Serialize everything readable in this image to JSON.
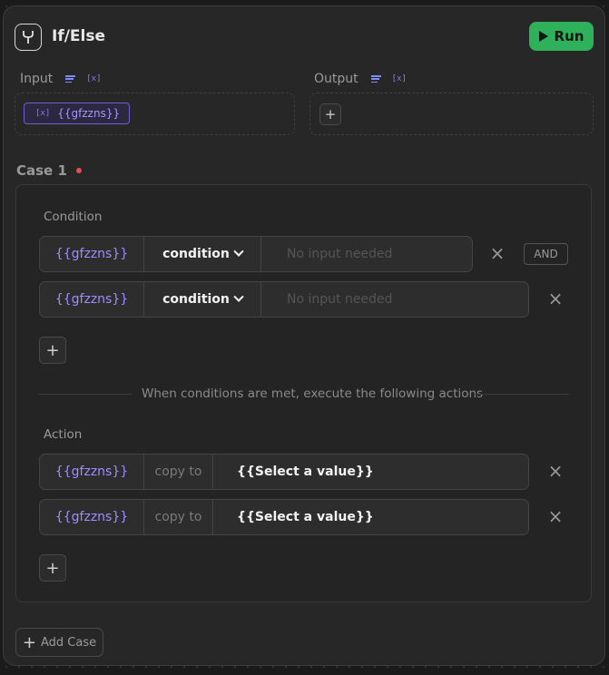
{
  "node": {
    "title": "If/Else",
    "run_label": "Run",
    "accent": "#2fb05a"
  },
  "io": {
    "input_label": "Input",
    "output_label": "Output",
    "input_chip": "{{gfzzns}}"
  },
  "case": {
    "label": "Case 1",
    "condition_label": "Condition",
    "conditions": [
      {
        "var": "{{gfzzns}}",
        "operator": "condition",
        "placeholder": "No input needed"
      },
      {
        "var": "{{gfzzns}}",
        "operator": "condition",
        "placeholder": "No input needed"
      }
    ],
    "and_label": "AND",
    "divider_text": "When conditions are met, execute the following actions",
    "action_label": "Action",
    "actions": [
      {
        "var": "{{gfzzns}}",
        "op": "copy to",
        "value": "{{Select a value}}"
      },
      {
        "var": "{{gfzzns}}",
        "op": "copy to",
        "value": "{{Select a value}}"
      }
    ]
  },
  "add_case_label": "Add Case"
}
